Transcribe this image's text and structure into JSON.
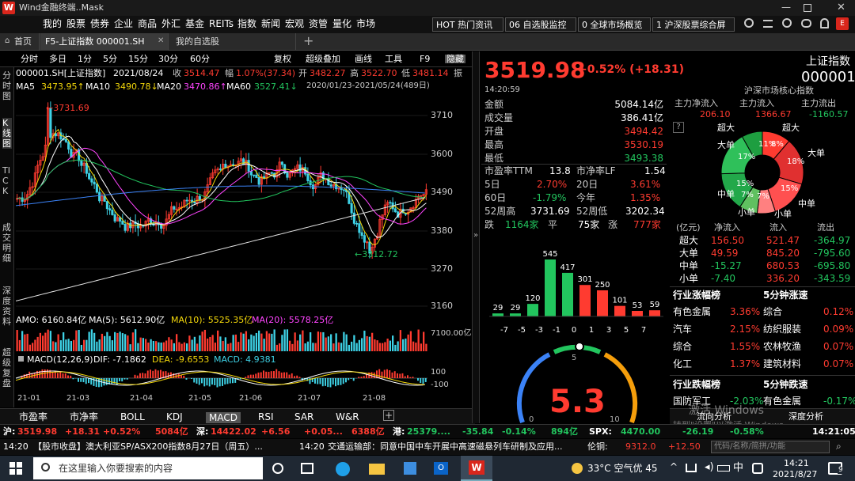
{
  "window": {
    "title": "Wind金融终端..Mask"
  },
  "menu": [
    "我的",
    "股票",
    "债券",
    "企业",
    "商品",
    "外汇",
    "基金",
    "REITs",
    "指数",
    "新闻",
    "宏观",
    "资管",
    "量化",
    "市场"
  ],
  "top_buttons": [
    "HOT 热门资讯",
    "06 自选股监控",
    "0 全球市场概览",
    "1 沪深股票综合屏"
  ],
  "tabs": [
    "首页",
    "F5-上证指数 000001.SH",
    "我的自选股"
  ],
  "tools": {
    "periods": [
      "分时",
      "多日",
      "1分",
      "5分",
      "15分",
      "30分",
      "60分"
    ],
    "right": [
      "复权",
      "超级叠加",
      "画线",
      "工具",
      "F9",
      "隐藏"
    ]
  },
  "side_tabs": [
    "分时图",
    "K线图",
    "TICK",
    "成交明细",
    "深度资料",
    "超级复盘"
  ],
  "info_row": {
    "code": "000001.SH[上证指数]",
    "date": "2021/08/24",
    "close_label": "收",
    "close": "3514.47",
    "range_label": "幅",
    "range": "1.07%(37.34)",
    "high_label": "开",
    "open": "3482.27",
    "hi_label": "高",
    "high": "3522.70",
    "lo_label": "低",
    "low": "3481.14",
    "amp_label": "振"
  },
  "ma_row": {
    "ma5": "MA5",
    "ma5v": "3473.95↑",
    "ma10": "MA10",
    "ma10v": "3490.78↓",
    "ma20": "MA20",
    "ma20v": "3470.86↑",
    "ma60": "MA60",
    "ma60v": "3527.41↓",
    "ma120v": "2020/01/23-2021/05/24(489日)"
  },
  "kline": {
    "y_ticks": [
      "3710",
      "3600",
      "3490",
      "3380",
      "3270",
      "3160"
    ],
    "max_label": "3731.69",
    "min_label": "3312.72",
    "x_labels": [
      "21-01",
      "21-03",
      "21-04",
      "21-05",
      "21-06",
      "21-07",
      "21-08"
    ]
  },
  "volume": {
    "label": "AMO: 6160.84亿",
    "ma5": "MA(5): 5612.90亿",
    "ma10": "MA(10): 5525.35亿",
    "ma20": "MA(20): 5578.25亿",
    "axis": "7100.00亿"
  },
  "macd": {
    "label": "MACD(12,26,9)",
    "dif": "DIF: -7.1862",
    "dea": "DEA: -9.6553",
    "macd": "MACD: 4.9381",
    "ticks": [
      "100",
      "-100"
    ]
  },
  "bottom_tabs": [
    "市盈率",
    "市净率",
    "BOLL",
    "KDJ",
    "MACD",
    "RSI",
    "SAR",
    "W&R"
  ],
  "quote": {
    "price": "3519.98",
    "change": "+0.52% (+18.31)",
    "time": "14:20:59",
    "name": "上证指数",
    "code": "000001",
    "sub": "沪深市场核心指数"
  },
  "stats": [
    [
      "金额",
      "5084.14亿"
    ],
    [
      "成交量",
      "386.41亿"
    ],
    [
      "开盘",
      "3494.42"
    ],
    [
      "最高",
      "3530.19"
    ],
    [
      "最低",
      "3493.38"
    ]
  ],
  "ratios": {
    "pe_label": "市盈率TTM",
    "pe": "13.8",
    "pb_label": "市净率LF",
    "pb": "1.54",
    "d5_label": "5日",
    "d5": "2.70%",
    "d20_label": "20日",
    "d20": "3.61%",
    "d60_label": "60日",
    "d60": "-1.79%",
    "ytd_label": "今年",
    "ytd": "1.35%",
    "hi52_label": "52周高",
    "hi52": "3731.69",
    "lo52_label": "52周低",
    "lo52": "3202.34",
    "down_label": "跌",
    "down": "1164家",
    "flat_label": "平",
    "flat": "75家",
    "up_label": "涨",
    "up": "777家"
  },
  "dist": {
    "labels": [
      "-7",
      "-5",
      "-3",
      "-1",
      "0",
      "1",
      "3",
      "5",
      "7"
    ],
    "bars": [
      29,
      29,
      120,
      545,
      417,
      301,
      250,
      101,
      53,
      59
    ],
    "colors": [
      "#22c55e",
      "#22c55e",
      "#22c55e",
      "#22c55e",
      "#22c55e",
      "#ff3b30",
      "#ff3b30",
      "#ff3b30",
      "#ff3b30",
      "#ff3b30"
    ]
  },
  "gauge": {
    "value": "5.3",
    "ticks": [
      "0",
      "5",
      "10"
    ]
  },
  "gauge_tabs": [
    "流向分析",
    "深度分析"
  ],
  "flow": {
    "in_label": "主力净流入",
    "in": "206.10",
    "inflow_label": "主力流入",
    "inflow": "1366.67",
    "out_label": "主力流出",
    "out": "-1160.57",
    "pie_labels": [
      "超大",
      "超大",
      "大单",
      "大单",
      "中单",
      "中单",
      "小单",
      "小单"
    ],
    "pie_pct": [
      "8%",
      "11%",
      "18%",
      "15%",
      "7%",
      "7%",
      "15%",
      "17%"
    ]
  },
  "flow_table": {
    "headers": [
      "(亿元)",
      "净流入",
      "流入",
      "流出"
    ],
    "rows": [
      [
        "超大",
        "156.50",
        "521.47",
        "-364.97"
      ],
      [
        "大单",
        "49.59",
        "845.20",
        "-795.60"
      ],
      [
        "中单",
        "-15.27",
        "680.53",
        "-695.80"
      ],
      [
        "小单",
        "-7.40",
        "336.20",
        "-343.59"
      ]
    ]
  },
  "industry_up": {
    "title": "行业涨幅榜",
    "title2": "5分钟涨速",
    "rows": [
      [
        "有色金属",
        "3.36%",
        "综合",
        "0.12%"
      ],
      [
        "汽车",
        "2.15%",
        "纺织服装",
        "0.09%"
      ],
      [
        "综合",
        "1.55%",
        "农林牧渔",
        "0.07%"
      ],
      [
        "化工",
        "1.37%",
        "建筑材料",
        "0.07%"
      ]
    ]
  },
  "industry_down": {
    "title": "行业跌幅榜",
    "title2": "5分钟跌速",
    "rows": [
      [
        "国防军工",
        "-2.03%",
        "有色金属",
        "-0.17%"
      ]
    ]
  },
  "ticker": {
    "sh_label": "沪:",
    "sh": "3519.98",
    "sh_chg": "+18.31",
    "sh_pct": "+0.52%",
    "sh_amt": "5084亿",
    "sz_label": "深:",
    "sz": "14422.02",
    "sz_chg": "+6.56",
    "sz_pct": "+0.05...",
    "sz_amt": "6388亿",
    "hk_label": "港:",
    "hk": "25379....",
    "hk_chg": "-35.84",
    "hk_pct": "-0.14%",
    "hk_amt": "894亿",
    "spx_label": "SPX:",
    "spx": "4470.00",
    "spx_chg": "-26.19",
    "spx_pct": "-0.58%",
    "time": "14:21:05"
  },
  "news": {
    "t1": "14:20",
    "n1": "【股市收盘】澳大利亚SP/ASX200指数8月27日（周五）...",
    "t2": "14:20",
    "n2": "交通运输部：同意中国中车开展中高速磁悬列车研制及应用...",
    "lun_label": "伦铜:",
    "lun": "9312.0",
    "lun_chg": "+12.50",
    "search": "代码/名称/简拼/功能"
  },
  "watermark": [
    "激活 Windows",
    "转到\"设置\"以激活 Windows。"
  ],
  "taskbar": {
    "search": "在这里输入你要搜索的内容",
    "weather": "33°C 空气优 45",
    "ime": "中",
    "time": "14:21",
    "date": "2021/8/27",
    "notif": "9"
  }
}
